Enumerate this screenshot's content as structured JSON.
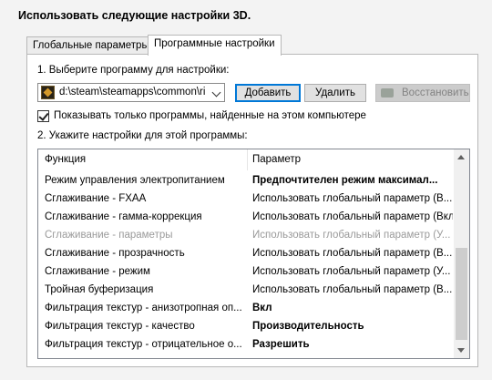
{
  "header": {
    "title": "Использовать следующие настройки 3D."
  },
  "tabs": [
    {
      "label": "Глобальные параметры",
      "active": false
    },
    {
      "label": "Программные настройки",
      "active": true
    }
  ],
  "program": {
    "step1_label": "1. Выберите программу для настройки:",
    "selected": "d:\\steam\\steamapps\\common\\ri...",
    "icon": "game-icon",
    "add_label": "Добавить",
    "remove_label": "Удалить",
    "restore_label": "Восстановить",
    "restore_icon": "nvidia-icon"
  },
  "filter": {
    "checked": true,
    "label": "Показывать только программы, найденные на этом компьютере"
  },
  "settings": {
    "step2_label": "2. Укажите настройки для этой программы:",
    "columns": [
      "Функция",
      "Параметр"
    ],
    "rows": [
      {
        "feature": "Режим управления электропитанием",
        "value": "Предпочтителен режим максимал...",
        "bold": true,
        "dim": false
      },
      {
        "feature": "Сглаживание - FXAA",
        "value": "Использовать глобальный параметр (В...",
        "bold": false,
        "dim": false
      },
      {
        "feature": "Сглаживание - гамма-коррекция",
        "value": "Использовать глобальный параметр (Вкл)",
        "bold": false,
        "dim": false
      },
      {
        "feature": "Сглаживание - параметры",
        "value": "Использовать глобальный параметр (У...",
        "bold": false,
        "dim": true
      },
      {
        "feature": "Сглаживание - прозрачность",
        "value": "Использовать глобальный параметр (В...",
        "bold": false,
        "dim": false
      },
      {
        "feature": "Сглаживание - режим",
        "value": "Использовать глобальный параметр (У...",
        "bold": false,
        "dim": false
      },
      {
        "feature": "Тройная буферизация",
        "value": "Использовать глобальный параметр (В...",
        "bold": false,
        "dim": false
      },
      {
        "feature": "Фильтрация текстур - анизотропная оп...",
        "value": "Вкл",
        "bold": true,
        "dim": false
      },
      {
        "feature": "Фильтрация текстур - качество",
        "value": "Производительность",
        "bold": true,
        "dim": false
      },
      {
        "feature": "Фильтрация текстур - отрицательное о...",
        "value": "Разрешить",
        "bold": true,
        "dim": false
      }
    ]
  },
  "colors": {
    "accent": "#0078d7",
    "disabled_text": "#838383",
    "dim_text": "#9a9a9a"
  }
}
